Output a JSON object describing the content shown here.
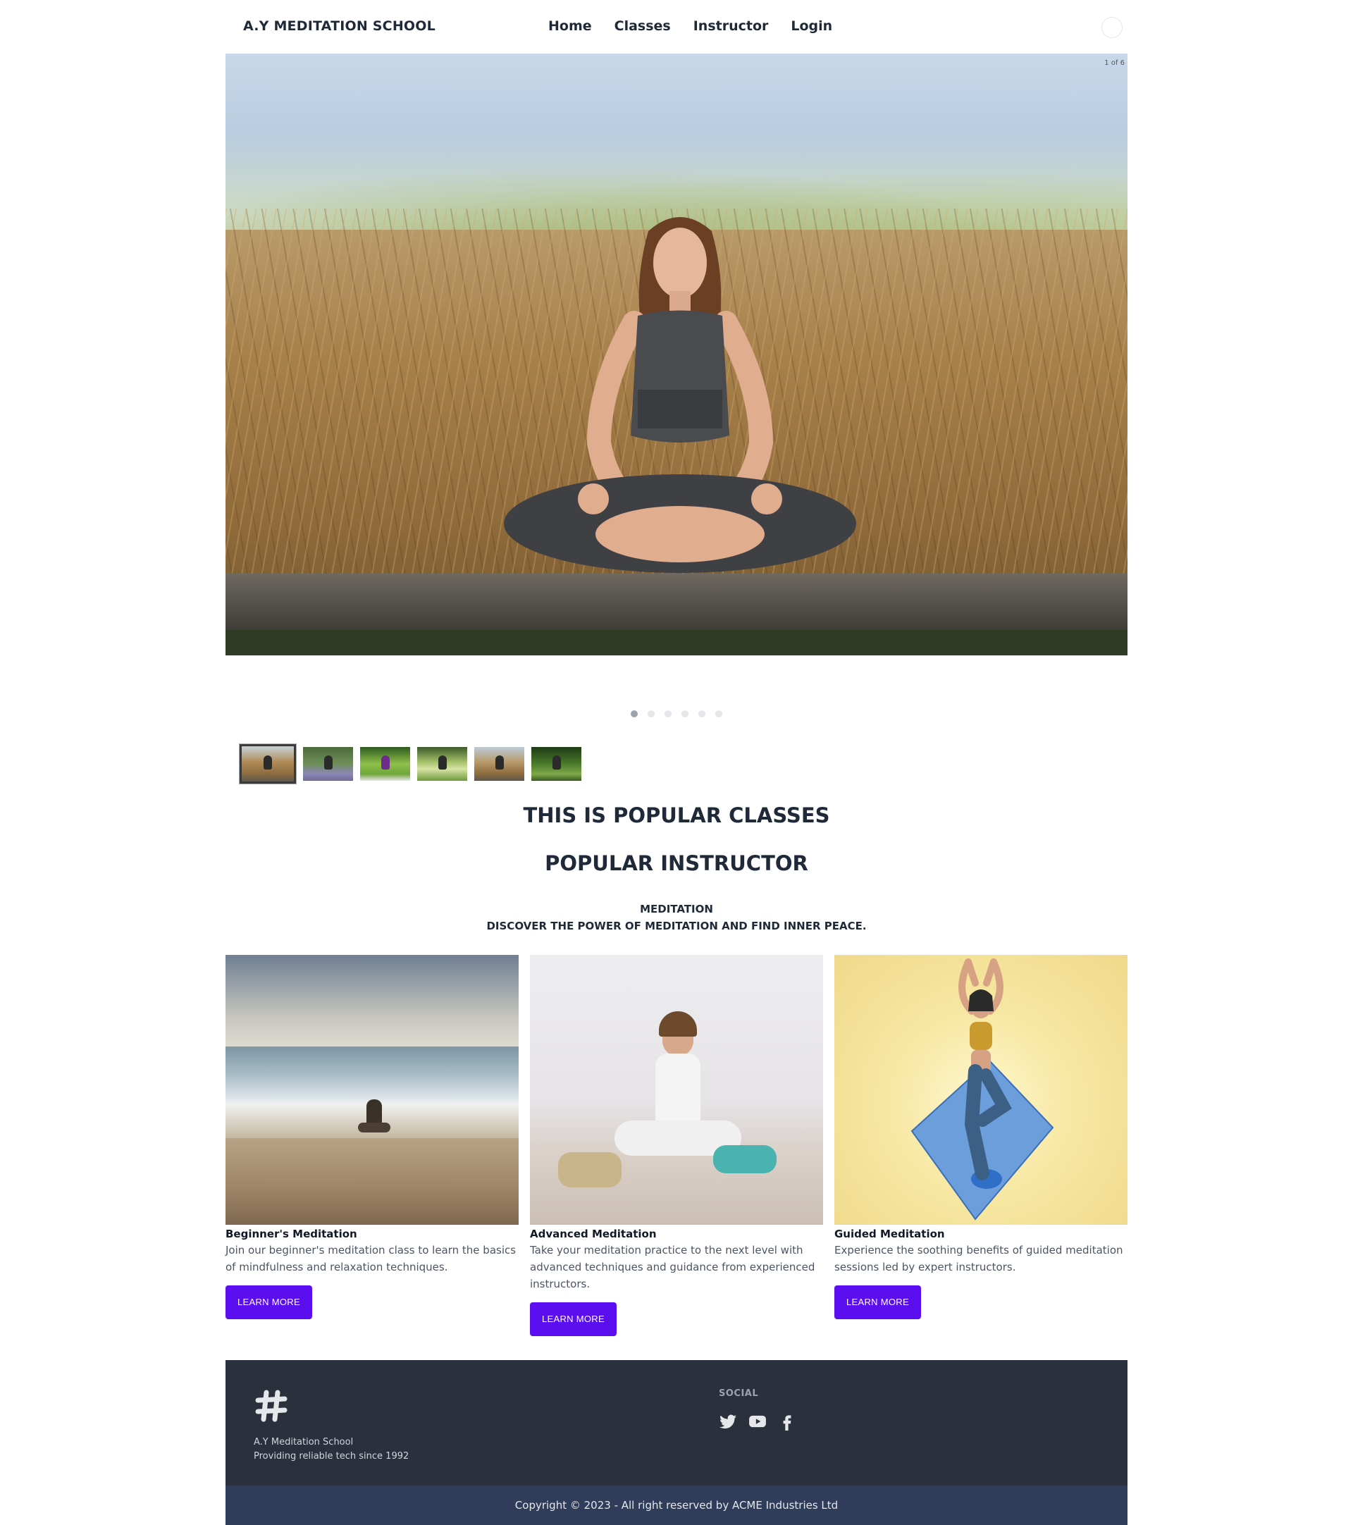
{
  "navbar": {
    "brand": "A.Y MEDITATION SCHOOL",
    "links": [
      "Home",
      "Classes",
      "Instructor",
      "Login"
    ]
  },
  "hero": {
    "counter": "1 of 6",
    "slide_count": 6,
    "active_slide": 1
  },
  "headings": {
    "popular_classes": "THIS IS POPULAR CLASSES",
    "popular_instructor": "POPULAR INSTRUCTOR",
    "section_title": "MEDITATION",
    "section_subtitle": "DISCOVER THE POWER OF MEDITATION AND FIND INNER PEACE."
  },
  "cards": [
    {
      "title": "Beginner's Meditation",
      "text": "Join our beginner's meditation class to learn the basics of mindfulness and relaxation techniques.",
      "button": "LEARN MORE"
    },
    {
      "title": "Advanced Meditation",
      "text": "Take your meditation practice to the next level with advanced techniques and guidance from experienced instructors.",
      "button": "LEARN MORE"
    },
    {
      "title": "Guided Meditation",
      "text": "Experience the soothing benefits of guided meditation sessions led by expert instructors.",
      "button": "LEARN MORE"
    }
  ],
  "footer": {
    "name": "A.Y Meditation School",
    "tagline": "Providing reliable tech since 1992",
    "social_title": "SOCIAL",
    "social_icons": [
      "twitter-icon",
      "youtube-icon",
      "facebook-icon"
    ],
    "copyright": "Copyright © 2023 - All right reserved by ACME Industries Ltd"
  },
  "colors": {
    "button": "#5b0ef0",
    "footer_bg": "#2a303c",
    "copyright_bg": "#2f3c5a",
    "text_dark": "#1f2937"
  }
}
